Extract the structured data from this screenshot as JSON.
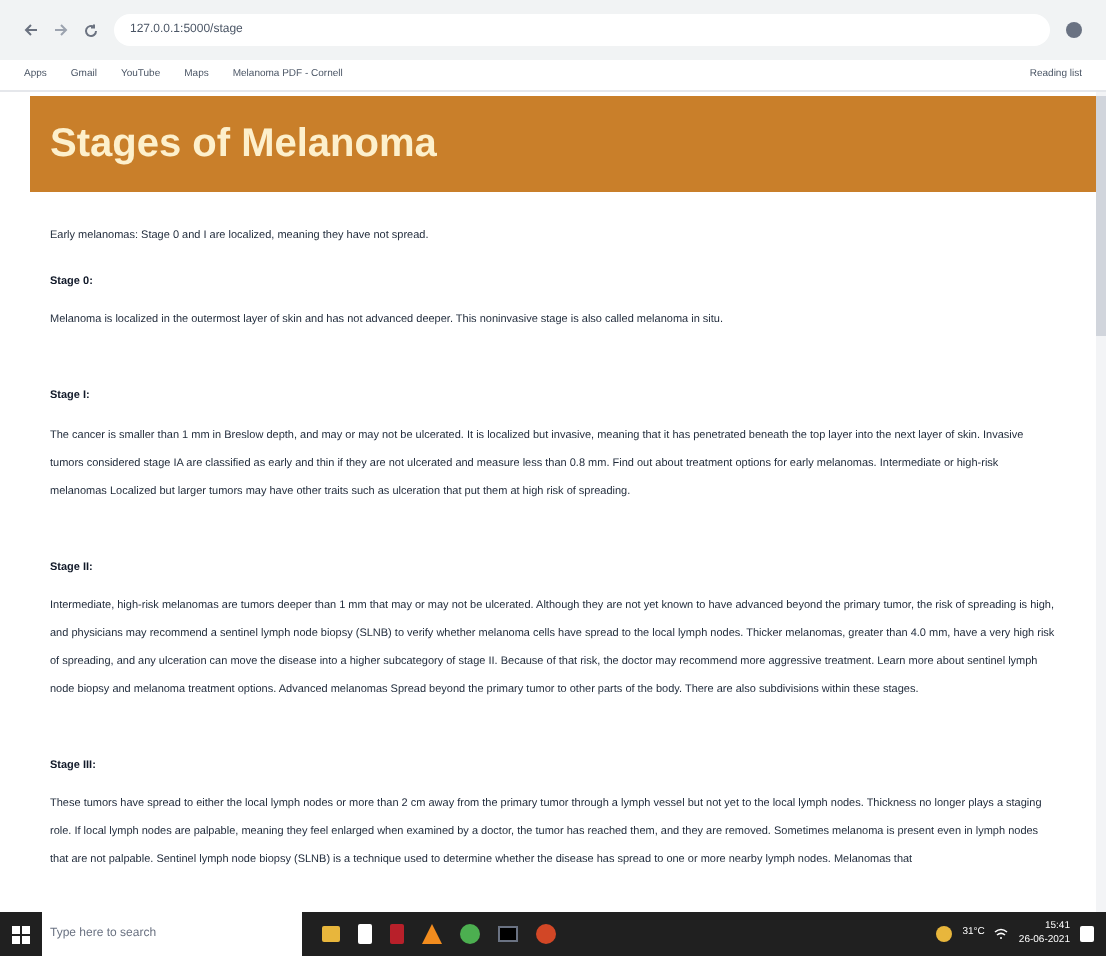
{
  "browser": {
    "address": "127.0.0.1:5000/stage",
    "bookmarks": [
      "Apps",
      "Gmail",
      "YouTube",
      "Maps",
      "Melanoma PDF - Cornell"
    ],
    "reading_list": "Reading list"
  },
  "page": {
    "title": "Stages of Melanoma",
    "intro": "Early melanomas: Stage 0 and I are localized, meaning they have not spread.",
    "sections": [
      {
        "heading": "Stage 0:",
        "text": "Melanoma is localized in the outermost layer of skin and has not advanced deeper. This noninvasive stage is also called melanoma in situ."
      },
      {
        "heading": "Stage I:",
        "text": "The cancer is smaller than 1 mm in Breslow depth, and may or may not be ulcerated. It is localized but invasive, meaning that it has penetrated beneath the top layer into the next layer of skin. Invasive tumors considered stage IA are classified as early and thin if they are not ulcerated and measure less than 0.8 mm. Find out about treatment options for early melanomas. Intermediate or high-risk melanomas Localized but larger tumors may have other traits such as ulceration that put them at high risk of spreading."
      },
      {
        "heading": "Stage II:",
        "text": "Intermediate, high-risk melanomas are tumors deeper than 1 mm that may or may not be ulcerated. Although they are not yet known to have advanced beyond the primary tumor, the risk of spreading is high, and physicians may recommend a sentinel lymph node biopsy (SLNB) to verify whether melanoma cells have spread to the local lymph nodes. Thicker melanomas, greater than 4.0 mm, have a very high risk of spreading, and any ulceration can move the disease into a higher subcategory of stage II. Because of that risk, the doctor may recommend more aggressive treatment. Learn more about sentinel lymph node biopsy and melanoma treatment options. Advanced melanomas Spread beyond the primary tumor to other parts of the body. There are also subdivisions within these stages."
      },
      {
        "heading": "Stage III:",
        "text": "These tumors have spread to either the local lymph nodes or more than 2 cm away from the primary tumor through a lymph vessel but not yet to the local lymph nodes. Thickness no longer plays a staging role. If local lymph nodes are palpable, meaning they feel enlarged when examined by a doctor, the tumor has reached them, and they are removed. Sometimes melanoma is present even in lymph nodes that are not palpable. Sentinel lymph node biopsy (SLNB) is a technique used to determine whether the disease has spread to one or more nearby lymph nodes. Melanomas that"
      }
    ]
  },
  "taskbar": {
    "search_placeholder": "Type here to search",
    "temperature": "31°C",
    "time": "15:41",
    "date": "26-06-2021"
  }
}
